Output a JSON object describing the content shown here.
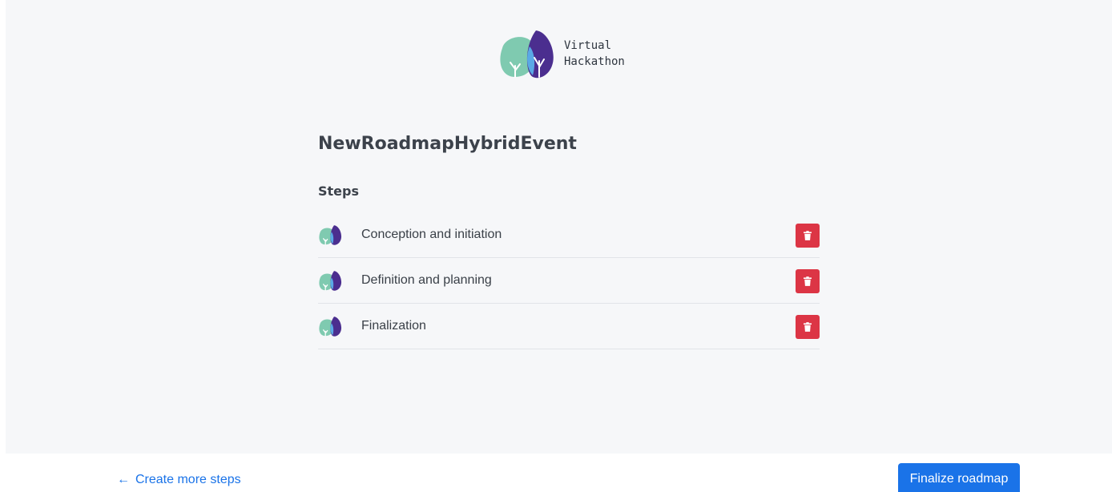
{
  "brand": {
    "line1": "Virtual",
    "line2": "Hackathon",
    "icon": "tree-logo-icon"
  },
  "roadmap": {
    "title": "NewRoadmapHybridEvent",
    "steps_heading": "Steps",
    "steps": [
      {
        "label": "Conception and initiation",
        "icon": "tree-logo-icon",
        "action_icon": "trash-icon"
      },
      {
        "label": "Definition and planning",
        "icon": "tree-logo-icon",
        "action_icon": "trash-icon"
      },
      {
        "label": "Finalization",
        "icon": "tree-logo-icon",
        "action_icon": "trash-icon"
      }
    ]
  },
  "footer": {
    "back_arrow": "←",
    "back_label": "Create more steps",
    "finalize_label": "Finalize roadmap"
  },
  "colors": {
    "panel_background": "#f6f7f9",
    "primary": "#1a73e8",
    "danger": "#dc3545",
    "logo_teal": "#7fcab0",
    "logo_purple": "#4b2e8f",
    "logo_blue": "#5aa9e6"
  }
}
